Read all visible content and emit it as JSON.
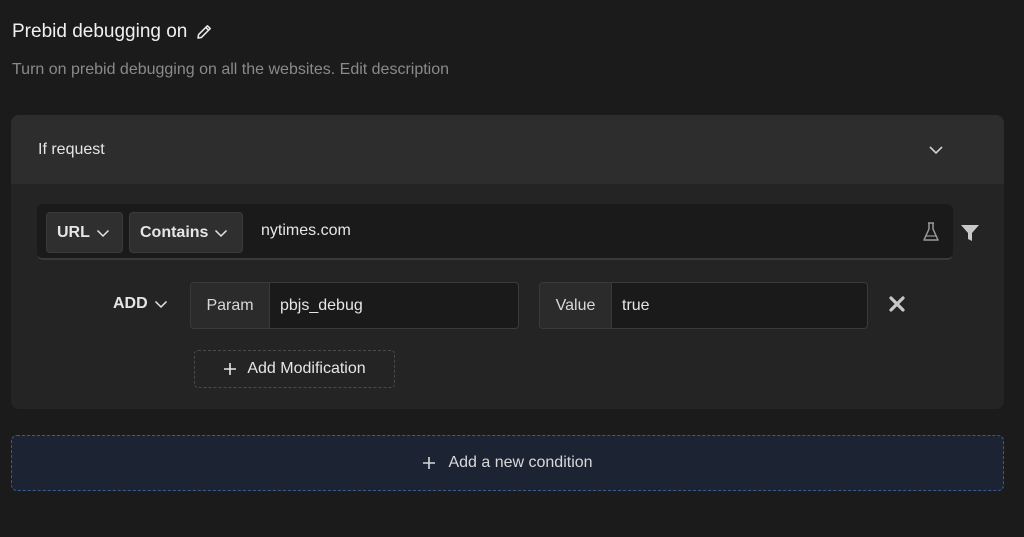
{
  "rule": {
    "title": "Prebid debugging on",
    "description": "Turn on prebid debugging on all the websites.",
    "edit_description_label": "Edit description"
  },
  "condition": {
    "header_label": "If request",
    "url_selector": "URL",
    "operator_selector": "Contains",
    "url_value": "nytimes.com"
  },
  "modification": {
    "action": "ADD",
    "param_label": "Param",
    "param_value": "pbjs_debug",
    "value_label": "Value",
    "value_value": "true"
  },
  "buttons": {
    "add_modification": "Add Modification",
    "add_condition": "Add a new condition"
  },
  "colors": {
    "background": "#1b1b1b",
    "card": "#242424",
    "accent_dashed": "#3b5a8f"
  }
}
